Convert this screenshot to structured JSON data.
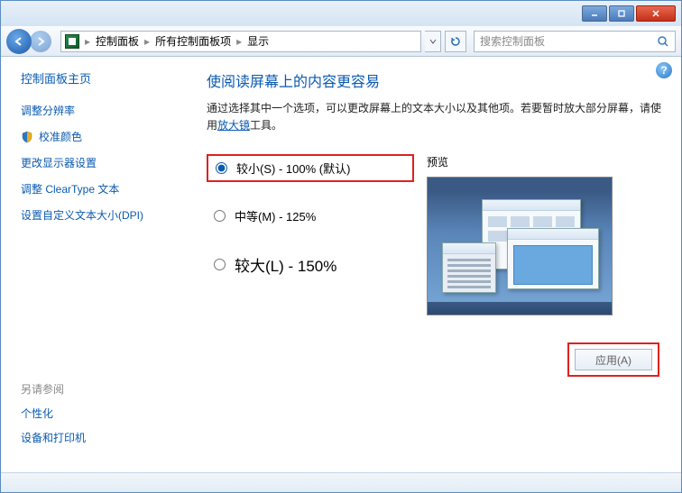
{
  "titlebar": {},
  "nav": {
    "crumbs": [
      "控制面板",
      "所有控制面板项",
      "显示"
    ],
    "search_placeholder": "搜索控制面板"
  },
  "sidebar": {
    "home": "控制面板主页",
    "links": [
      {
        "label": "调整分辨率"
      },
      {
        "label": "校准颜色",
        "shield": true
      },
      {
        "label": "更改显示器设置"
      },
      {
        "label": "调整 ClearType 文本"
      },
      {
        "label": "设置自定义文本大小(DPI)"
      }
    ],
    "see_also_title": "另请参阅",
    "see_also": [
      "个性化",
      "设备和打印机"
    ]
  },
  "main": {
    "title": "使阅读屏幕上的内容更容易",
    "desc_prefix": "通过选择其中一个选项，可以更改屏幕上的文本大小以及其他项。若要暂时放大部分屏幕，请使用",
    "desc_link": "放大镜",
    "desc_suffix": "工具。",
    "options": [
      {
        "label": "较小(S) - 100% (默认)",
        "size": "sm",
        "checked": true
      },
      {
        "label": "中等(M) - 125%",
        "size": "sm",
        "checked": false
      },
      {
        "label": "较大(L) - 150%",
        "size": "lg",
        "checked": false
      }
    ],
    "preview_label": "预览",
    "apply_label": "应用(A)"
  }
}
